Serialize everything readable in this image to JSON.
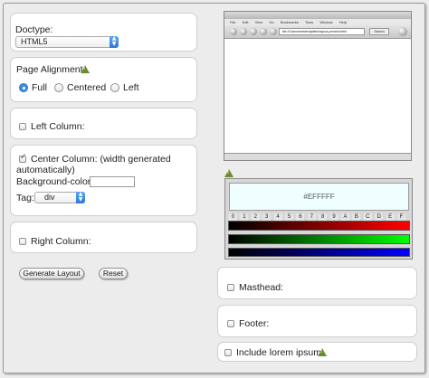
{
  "doctype": {
    "label": "Doctype:",
    "selected": "HTML5"
  },
  "page_alignment": {
    "label": "Page Alignment:",
    "options": [
      "Full",
      "Centered",
      "Left"
    ],
    "selected": "Full"
  },
  "left_column": {
    "label": "Left Column:",
    "checked": false
  },
  "center_column": {
    "label_line1": "Center Column: (width generated",
    "label_line2": "automatically)",
    "checked": true,
    "bg_label": "Background-color:",
    "bg_value": "",
    "tag_label": "Tag:",
    "tag_selected": "div"
  },
  "right_column": {
    "label": "Right Column:",
    "checked": false
  },
  "buttons": {
    "generate": "Generate Layout",
    "reset": "Reset"
  },
  "preview": {
    "url": "file:///Users/webtemplates/layout-preview.html",
    "search": "Search",
    "menu": [
      "File",
      "Edit",
      "View",
      "Go",
      "Bookmarks",
      "Tools",
      "Window",
      "Help"
    ]
  },
  "color_picker": {
    "hex_value": "#EFFFFF",
    "hex_keys": [
      "0",
      "1",
      "2",
      "3",
      "4",
      "5",
      "6",
      "7",
      "8",
      "9",
      "A",
      "B",
      "C",
      "D",
      "E",
      "F"
    ],
    "channels": [
      "red",
      "green",
      "blue"
    ]
  },
  "masthead": {
    "label": "Masthead:",
    "checked": false
  },
  "footer": {
    "label": "Footer:",
    "checked": false
  },
  "lorem": {
    "label": "Include lorem ipsum:",
    "checked": false
  },
  "colors": {
    "accent": "#3b8fe6",
    "warning": "#6e8b2c",
    "swatch": "#efffff"
  }
}
